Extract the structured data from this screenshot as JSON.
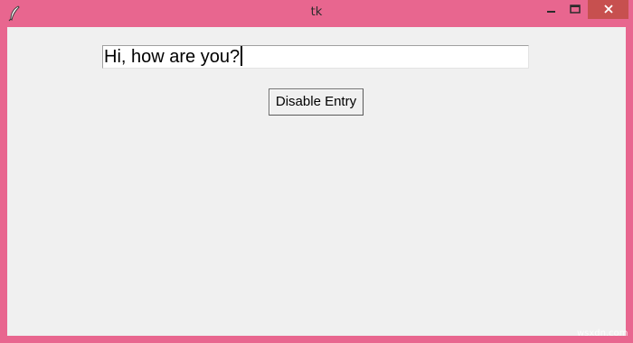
{
  "window": {
    "title": "tk",
    "icons": {
      "app": "feather-icon",
      "minimize": "minimize-icon",
      "maximize": "maximize-icon",
      "close": "close-icon"
    },
    "colors": {
      "frame": "#e8668f",
      "client_bg": "#f0f0f0",
      "close_button": "#c7504f"
    }
  },
  "main": {
    "entry_value": "Hi, how are you?",
    "disable_button_label": "Disable Entry"
  },
  "watermark": "wsxdn.com"
}
